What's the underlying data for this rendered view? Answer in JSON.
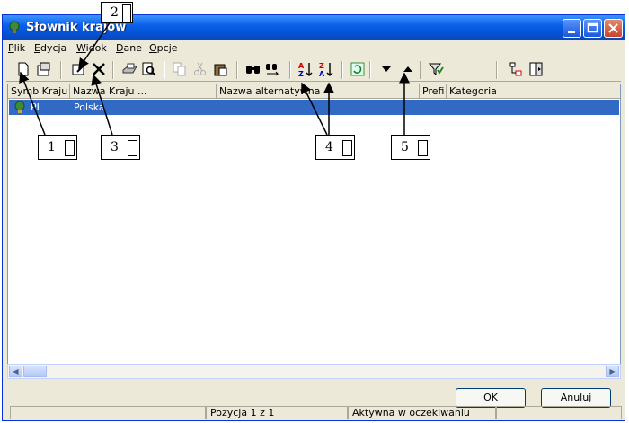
{
  "window": {
    "title": "Słownik krajów"
  },
  "menu": [
    {
      "label_u": "P",
      "label_rest": "lik"
    },
    {
      "label_u": "E",
      "label_rest": "dycja"
    },
    {
      "label_u": "W",
      "label_rest": "idok"
    },
    {
      "label_u": "D",
      "label_rest": "ane"
    },
    {
      "label_u": "O",
      "label_rest": "pcje"
    }
  ],
  "toolbar_icons": [
    "new-icon",
    "properties-icon",
    "edit-icon",
    "delete-icon",
    "print-icon",
    "print-preview-icon",
    "copy-icon",
    "cut-icon",
    "paste-icon",
    "find-icon",
    "find-next-icon",
    "sort-ascending-icon",
    "sort-descending-icon",
    "refresh-icon",
    "move-down-icon",
    "move-up-icon",
    "filter-icon",
    "tree-icon",
    "columns-icon"
  ],
  "grid": {
    "columns": [
      "Symb Kraju",
      "Nazwa Kraju ...",
      "Nazwa alternatywna",
      "Prefi",
      "Kategoria"
    ],
    "rows": [
      {
        "symbol": "PL",
        "name": "Polska",
        "alt": "",
        "prefix": "",
        "category": ""
      }
    ]
  },
  "buttons": {
    "ok": "OK",
    "cancel": "Anuluj"
  },
  "status": {
    "position": "Pozycja 1 z 1",
    "state": "Aktywna w oczekiwaniu"
  },
  "annotations": [
    "1",
    "2",
    "3",
    "4",
    "5"
  ],
  "colors": {
    "selection": "#316ac5",
    "titlebar": "#0553d6"
  }
}
